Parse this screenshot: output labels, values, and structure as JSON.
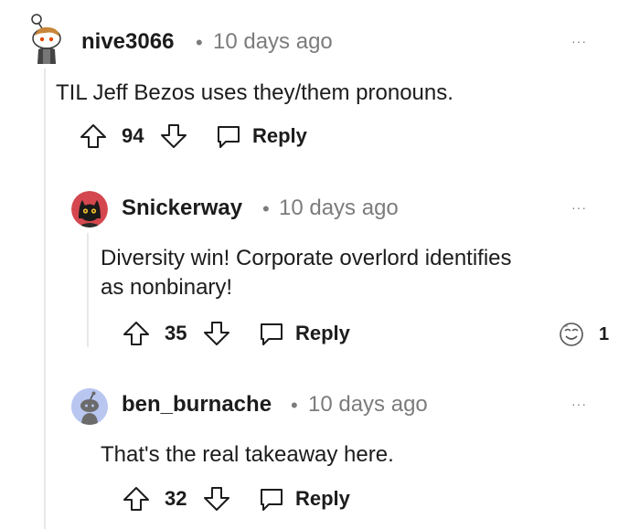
{
  "comments": [
    {
      "username": "nive3066",
      "separator": "•",
      "time": "10 days ago",
      "more": "···",
      "text": "TIL Jeff Bezos uses they/them pronouns.",
      "votes": "94",
      "reply_label": "Reply",
      "avatar_icon": "snoo-avatar-icon"
    },
    {
      "username": "Snickerway",
      "separator": "•",
      "time": "10 days ago",
      "more": "···",
      "text_lines": [
        "Diversity win! Corporate overlord identifies",
        "as nonbinary!"
      ],
      "votes": "35",
      "reply_label": "Reply",
      "award_count": "1",
      "avatar_icon": "black-cat-avatar-icon"
    },
    {
      "username": "ben_burnache",
      "separator": "•",
      "time": "10 days ago",
      "more": "···",
      "text": "That's the real takeaway here.",
      "votes": "32",
      "reply_label": "Reply",
      "avatar_icon": "default-snoo-avatar-icon"
    }
  ],
  "colors": {
    "text": "#1c1c1c",
    "meta": "#7c7c7c",
    "thread_line": "#e8e8e8",
    "default_avatar_bg": "#b8c6f0"
  }
}
